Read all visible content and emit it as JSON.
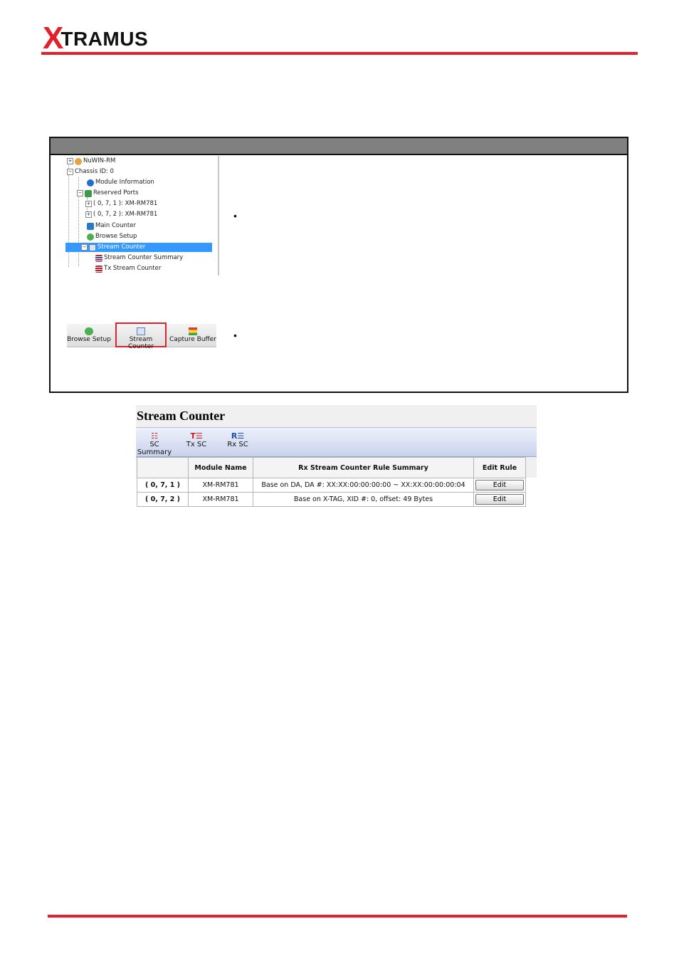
{
  "header": {
    "logo_x": "X",
    "logo_rest": "TRAMUS"
  },
  "tree": {
    "nodes": [
      "NuWIN-RM",
      "Chassis ID: 0",
      "Module Information",
      "Reserved Ports",
      "( 0, 7, 1 ): XM-RM781",
      "( 0, 7, 2 ): XM-RM781",
      "Main Counter",
      "Browse Setup",
      "Stream Counter",
      "Stream Counter Summary",
      "Tx Stream Counter"
    ],
    "selected": "Stream Counter"
  },
  "bullets": [
    "•",
    "•"
  ],
  "toolbar": {
    "buttons": [
      "Browse Setup",
      "Stream Counter",
      "Capture Buffer"
    ],
    "highlighted": "Stream Counter"
  },
  "stream_counter": {
    "title": "Stream Counter",
    "tabs": [
      {
        "icon": "☷",
        "label": "SC Summary"
      },
      {
        "icon": "T☰",
        "label": "Tx SC"
      },
      {
        "icon": "R☰",
        "label": "Rx SC"
      }
    ],
    "columns": [
      "",
      "Module Name",
      "Rx Stream Counter Rule Summary",
      "Edit Rule"
    ],
    "rows": [
      {
        "port": "( 0, 7, 1 )",
        "module": "XM-RM781",
        "summary": "Base on DA, DA #: XX:XX:00:00:00:00 ~ XX:XX:00:00:00:04",
        "action": "Edit"
      },
      {
        "port": "( 0, 7, 2 )",
        "module": "XM-RM781",
        "summary": "Base on X-TAG, XID #: 0, offset: 49 Bytes",
        "action": "Edit"
      }
    ]
  },
  "colors": {
    "brand_red": "#e3202b",
    "selection_blue": "#3399ff",
    "highlight_box": "#d9232d"
  }
}
